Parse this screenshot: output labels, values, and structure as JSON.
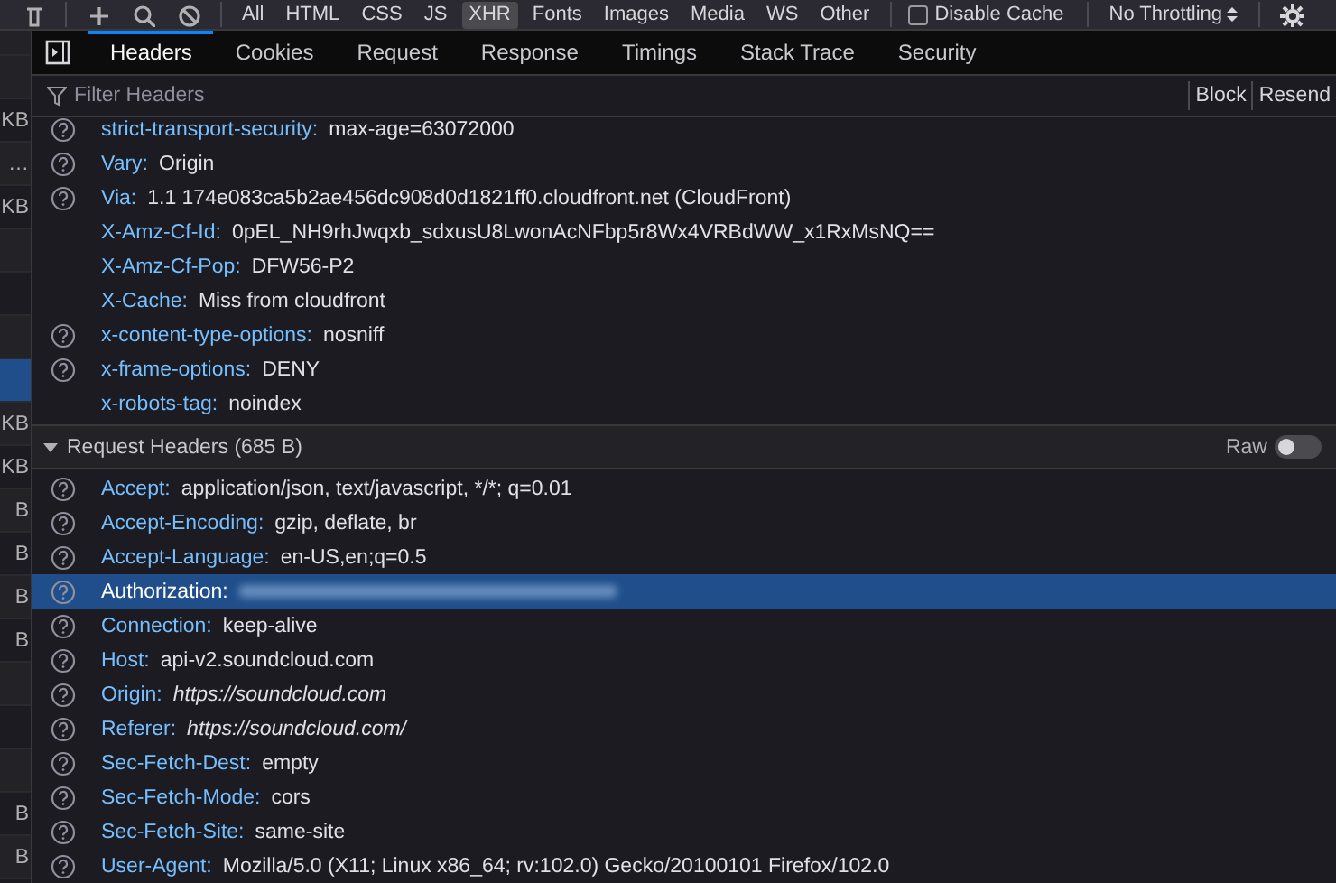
{
  "toolbar": {
    "filters": [
      {
        "label": "All",
        "selected": false
      },
      {
        "label": "HTML",
        "selected": false
      },
      {
        "label": "CSS",
        "selected": false
      },
      {
        "label": "JS",
        "selected": false
      },
      {
        "label": "XHR",
        "selected": true
      },
      {
        "label": "Fonts",
        "selected": false
      },
      {
        "label": "Images",
        "selected": false
      },
      {
        "label": "Media",
        "selected": false
      },
      {
        "label": "WS",
        "selected": false
      },
      {
        "label": "Other",
        "selected": false
      }
    ],
    "disable_cache": {
      "label": "Disable Cache",
      "checked": false
    },
    "throttling": {
      "value": "No Throttling"
    }
  },
  "request_list": {
    "rows": [
      {
        "size": "",
        "selected": false
      },
      {
        "size": "KB",
        "selected": false
      },
      {
        "size": "…",
        "selected": false
      },
      {
        "size": "KB",
        "selected": false
      },
      {
        "size": "",
        "selected": false
      },
      {
        "size": "",
        "selected": false
      },
      {
        "size": "",
        "selected": false
      },
      {
        "size": "",
        "selected": true
      },
      {
        "size": "KB",
        "selected": false
      },
      {
        "size": "KB",
        "selected": false
      },
      {
        "size": "B",
        "selected": false
      },
      {
        "size": "B",
        "selected": false
      },
      {
        "size": "B",
        "selected": false
      },
      {
        "size": "B",
        "selected": false
      },
      {
        "size": "",
        "selected": false
      },
      {
        "size": "",
        "selected": false
      },
      {
        "size": "",
        "selected": false
      },
      {
        "size": "B",
        "selected": false
      },
      {
        "size": "B",
        "selected": false
      }
    ]
  },
  "details": {
    "tabs": [
      {
        "label": "Headers",
        "selected": true
      },
      {
        "label": "Cookies",
        "selected": false
      },
      {
        "label": "Request",
        "selected": false
      },
      {
        "label": "Response",
        "selected": false
      },
      {
        "label": "Timings",
        "selected": false
      },
      {
        "label": "Stack Trace",
        "selected": false
      },
      {
        "label": "Security",
        "selected": false
      }
    ],
    "filter": {
      "placeholder": "Filter Headers"
    },
    "actions": [
      "Block",
      "Resend"
    ],
    "response_headers": [
      {
        "name": "strict-transport-security:",
        "value": "max-age=63072000",
        "help": true,
        "kind": "plain",
        "selected": false
      },
      {
        "name": "Vary:",
        "value": "Origin",
        "help": true,
        "kind": "plain",
        "selected": false
      },
      {
        "name": "Via:",
        "value": "1.1 174e083ca5b2ae456dc908d0d1821ff0.cloudfront.net (CloudFront)",
        "help": true,
        "kind": "plain",
        "selected": false
      },
      {
        "name": "X-Amz-Cf-Id:",
        "value": "0pEL_NH9rhJwqxb_sdxusU8LwonAcNFbp5r8Wx4VRBdWW_x1RxMsNQ==",
        "help": false,
        "kind": "plain",
        "selected": false
      },
      {
        "name": "X-Amz-Cf-Pop:",
        "value": "DFW56-P2",
        "help": false,
        "kind": "plain",
        "selected": false
      },
      {
        "name": "X-Cache:",
        "value": "Miss from cloudfront",
        "help": false,
        "kind": "plain",
        "selected": false
      },
      {
        "name": "x-content-type-options:",
        "value": "nosniff",
        "help": true,
        "kind": "plain",
        "selected": false
      },
      {
        "name": "x-frame-options:",
        "value": "DENY",
        "help": true,
        "kind": "plain",
        "selected": false
      },
      {
        "name": "x-robots-tag:",
        "value": "noindex",
        "help": false,
        "kind": "plain",
        "selected": false
      }
    ],
    "request_section": {
      "title": "Request Headers (685 B)",
      "expanded": true,
      "raw": {
        "label": "Raw",
        "on": false
      }
    },
    "request_headers": [
      {
        "name": "Accept:",
        "value": "application/json, text/javascript, */*; q=0.01",
        "help": true,
        "kind": "plain",
        "selected": false
      },
      {
        "name": "Accept-Encoding:",
        "value": "gzip, deflate, br",
        "help": true,
        "kind": "plain",
        "selected": false
      },
      {
        "name": "Accept-Language:",
        "value": "en-US,en;q=0.5",
        "help": true,
        "kind": "plain",
        "selected": false
      },
      {
        "name": "Authorization:",
        "help": true,
        "kind": "redacted",
        "selected": true
      },
      {
        "name": "Connection:",
        "value": "keep-alive",
        "help": true,
        "kind": "plain",
        "selected": false
      },
      {
        "name": "Host:",
        "value": "api-v2.soundcloud.com",
        "help": true,
        "kind": "plain",
        "selected": false
      },
      {
        "name": "Origin:",
        "value": "https://soundcloud.com",
        "help": true,
        "kind": "url",
        "selected": false
      },
      {
        "name": "Referer:",
        "value": "https://soundcloud.com/",
        "help": true,
        "kind": "url",
        "selected": false
      },
      {
        "name": "Sec-Fetch-Dest:",
        "value": "empty",
        "help": true,
        "kind": "plain",
        "selected": false
      },
      {
        "name": "Sec-Fetch-Mode:",
        "value": "cors",
        "help": true,
        "kind": "plain",
        "selected": false
      },
      {
        "name": "Sec-Fetch-Site:",
        "value": "same-site",
        "help": true,
        "kind": "plain",
        "selected": false
      },
      {
        "name": "User-Agent:",
        "value": "Mozilla/5.0 (X11; Linux x86_64; rv:102.0) Gecko/20100101 Firefox/102.0",
        "help": true,
        "kind": "plain",
        "selected": false
      }
    ]
  }
}
